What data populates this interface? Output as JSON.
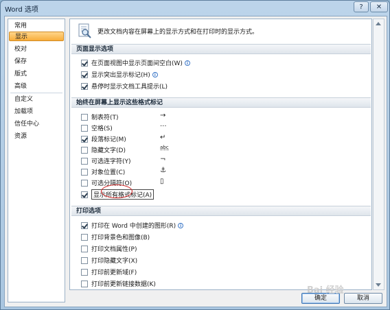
{
  "window": {
    "title": "Word 选项",
    "help_glyph": "?",
    "close_glyph": "✕"
  },
  "nav": {
    "items": [
      {
        "label": "常用"
      },
      {
        "label": "显示"
      },
      {
        "label": "校对"
      },
      {
        "label": "保存"
      },
      {
        "label": "版式"
      },
      {
        "label": "高级"
      },
      {
        "label": "自定义"
      },
      {
        "label": "加载项"
      },
      {
        "label": "信任中心"
      },
      {
        "label": "资源"
      }
    ],
    "active": "显示"
  },
  "header": {
    "text": "更改文档内容在屏幕上的显示方式和在打印时的显示方式。",
    "icon": "display-options-icon"
  },
  "sections": {
    "page_display": {
      "title": "页面显示选项",
      "items": [
        {
          "label": "在页面视图中显示页面间空白(W)",
          "checked": true,
          "info": true
        },
        {
          "label": "显示突出显示标记(H)",
          "checked": true,
          "info": true
        },
        {
          "label": "悬停时显示文档工具提示(L)",
          "checked": true,
          "info": false
        }
      ]
    },
    "format_marks": {
      "title": "始终在屏幕上显示这些格式标记",
      "items": [
        {
          "label": "制表符(T)",
          "checked": false,
          "symbol": "→"
        },
        {
          "label": "空格(S)",
          "checked": false,
          "symbol": "···"
        },
        {
          "label": "段落标记(M)",
          "checked": true,
          "symbol": "↵"
        },
        {
          "label": "隐藏文字(D)",
          "checked": false,
          "symbol": "a̲b̲c̲"
        },
        {
          "label": "可选连字符(Y)",
          "checked": false,
          "symbol": "¬"
        },
        {
          "label": "对象位置(C)",
          "checked": false,
          "symbol": "⚓"
        },
        {
          "label": "可选分隔符(O)",
          "checked": false,
          "symbol": "▯"
        },
        {
          "label": "显示所有格式标记(A)",
          "checked": true,
          "symbol": ""
        }
      ]
    },
    "print": {
      "title": "打印选项",
      "items": [
        {
          "label": "打印在 Word 中创建的图形(R)",
          "checked": true,
          "info": true
        },
        {
          "label": "打印背景色和图像(B)",
          "checked": false,
          "info": false
        },
        {
          "label": "打印文档属性(P)",
          "checked": false,
          "info": false
        },
        {
          "label": "打印隐藏文字(X)",
          "checked": false,
          "info": false
        },
        {
          "label": "打印前更新域(F)",
          "checked": false,
          "info": false
        },
        {
          "label": "打印前更新链接数据(K)",
          "checked": false,
          "info": false
        }
      ]
    }
  },
  "buttons": {
    "ok": "确定",
    "cancel": "取消"
  },
  "watermark": "Bai 经验",
  "colors": {
    "accent": "#f8ad3a",
    "highlight_circle": "#d42020"
  }
}
